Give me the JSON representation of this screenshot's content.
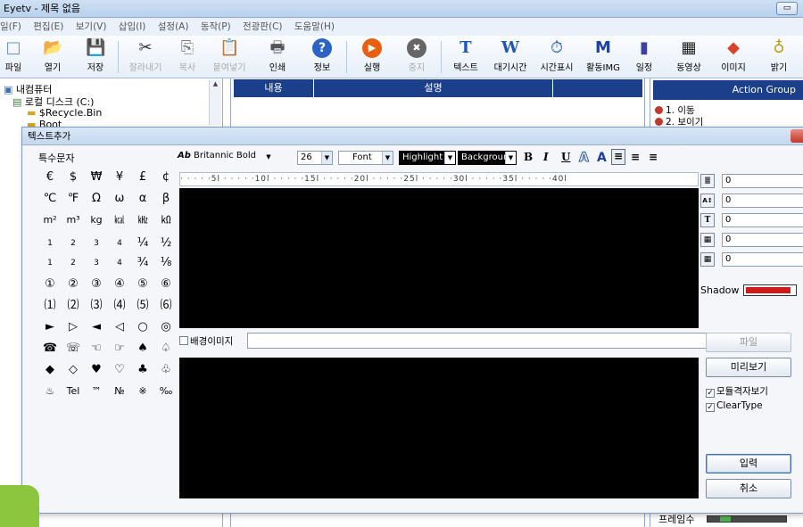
{
  "window": {
    "title": "Eyetv - 제목 없음",
    "minimize_glyph": "▭"
  },
  "menu": [
    "일(F)",
    "편집(E)",
    "보기(V)",
    "삽입(I)",
    "설정(A)",
    "동작(P)",
    "전광판(C)",
    "도움말(H)"
  ],
  "toolbar": [
    {
      "label": "파일",
      "icon": "□"
    },
    {
      "label": "열기",
      "icon": "📂"
    },
    {
      "label": "저장",
      "icon": "💾"
    },
    {
      "label": "잘라내기",
      "icon": "✂"
    },
    {
      "label": "복사",
      "icon": "⎘"
    },
    {
      "label": "붙여넣기",
      "icon": "📋"
    },
    {
      "label": "인쇄",
      "icon": "🖶"
    },
    {
      "label": "정보",
      "icon": "?"
    },
    {
      "label": "실행",
      "icon": "▶"
    },
    {
      "label": "중지",
      "icon": "✖"
    },
    {
      "label": "텍스트",
      "icon": "T"
    },
    {
      "label": "대기시간",
      "icon": "W"
    },
    {
      "label": "시간표시",
      "icon": "⏱"
    },
    {
      "label": "활동IMG",
      "icon": "M"
    },
    {
      "label": "일정",
      "icon": "▮"
    },
    {
      "label": "동영상",
      "icon": "▦"
    },
    {
      "label": "이미지",
      "icon": "◆"
    },
    {
      "label": "밝기",
      "icon": "♁"
    }
  ],
  "tree": {
    "items": [
      "내컴퓨터",
      "로컬 디스크 (C:)",
      "$Recycle.Bin",
      "Boot"
    ],
    "scroll_up": "▲"
  },
  "table": {
    "col1": "내용",
    "col2": "설명"
  },
  "action_group": {
    "title": "Action Group",
    "items": [
      "1. 이동",
      "2. 보이기"
    ]
  },
  "frame": {
    "label": "프레임수"
  },
  "dialog": {
    "title": "텍스트추가",
    "special_chars_label": "특수문자",
    "special_chars": [
      [
        "€",
        "$",
        "₩",
        "¥",
        "£",
        "¢"
      ],
      [
        "℃",
        "℉",
        "Ω",
        "ω",
        "α",
        "β"
      ],
      [
        "m²",
        "m³",
        "kg",
        "㎉",
        "㎑",
        "㏀"
      ],
      [
        "1",
        "2",
        "3",
        "4",
        "¼",
        "½"
      ],
      [
        "1",
        "2",
        "3",
        "4",
        "¾",
        "⅛"
      ],
      [
        "①",
        "②",
        "③",
        "④",
        "⑤",
        "⑥"
      ],
      [
        "⑴",
        "⑵",
        "⑶",
        "⑷",
        "⑸",
        "⑹"
      ],
      [
        "►",
        "▷",
        "◄",
        "◁",
        "○",
        "◎"
      ],
      [
        "☎",
        "☏",
        "☜",
        "☞",
        "♠",
        "♤"
      ],
      [
        "◆",
        "◇",
        "♥",
        "♡",
        "♣",
        "♧"
      ],
      [
        "♨",
        "Tel",
        "™",
        "№",
        "※",
        "‰"
      ]
    ],
    "font_icon": "Ab",
    "font_name": "Britannic Bold",
    "font_size": "26",
    "font_dropdown": "Font",
    "highlight_dropdown": "Highlight",
    "background_dropdown": "Background",
    "fmt_bold": "B",
    "fmt_italic": "I",
    "fmt_underline": "U",
    "fmt_outline": "A",
    "fmt_color": "A",
    "fmt_align_left": "≡",
    "fmt_align_center": "≡",
    "fmt_align_right": "≡",
    "ruler": "· · · · ·5l · · · · ·10l · · · · ·15l · · · · ·20l · · · · ·25l · · · · ·30l · · · · ·35l · · · · ·40l",
    "bg_image_label": "배경이미지",
    "side_fields": [
      {
        "icon": "≣",
        "value": "0"
      },
      {
        "icon": "A↕",
        "value": "0"
      },
      {
        "icon": "T",
        "value": "0"
      },
      {
        "icon": "▦",
        "value": "0"
      },
      {
        "icon": "▦",
        "value": "0"
      }
    ],
    "shadow_label": "Shadow",
    "shadow_color": "#d11a1a",
    "btn_file": "파일",
    "btn_preview": "미리보기",
    "chk_grid": "모듈격자보기",
    "chk_cleartype": "ClearType",
    "chk_mark": "✓",
    "btn_input": "입력",
    "btn_cancel": "취소"
  }
}
